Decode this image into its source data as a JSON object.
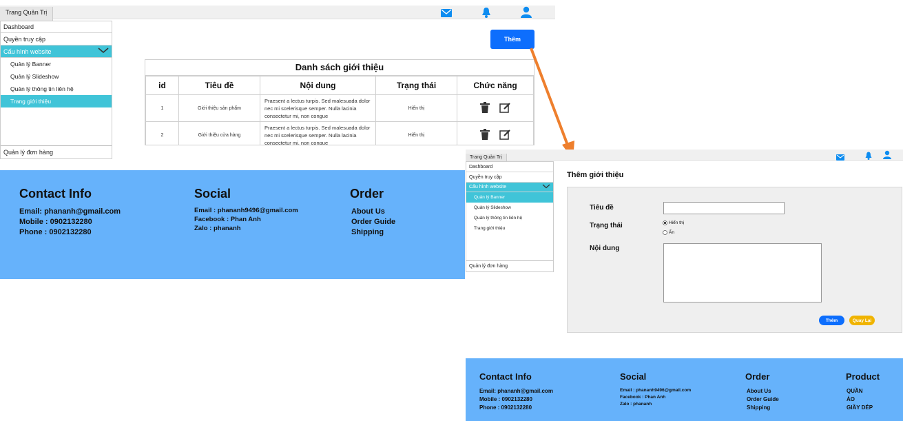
{
  "left": {
    "topbar": {
      "title": "Trang Quản Trị"
    },
    "sidebar": {
      "items": [
        "Dashboard",
        "Quyền truy cập",
        "Cấu hình website"
      ],
      "subitems": [
        "Quản lý Banner",
        "Quản lý Slideshow",
        "Quản lý thông tin liên hệ",
        "Trang giới thiệu"
      ],
      "bottom": "Quản lý đơn hàng"
    },
    "add_button": "Thêm",
    "table": {
      "caption": "Danh sách giới thiệu",
      "headers": [
        "id",
        "Tiêu đề",
        "Nội dung",
        "Trạng thái",
        "Chức năng"
      ],
      "rows": [
        {
          "id": "1",
          "title": "Giới thiệu sản phẩm",
          "content": "Praesent a lectus turpis. Sed malesuada dolor nec mi scelerisque semper. Nulla lacinia consectetur mi, non congue",
          "status": "Hiển thị"
        },
        {
          "id": "2",
          "title": "Giới thiệu cửa hàng",
          "content": "Praesent a lectus turpis. Sed malesuada dolor nec mi scelerisque semper. Nulla lacinia consectetur mi, non congue",
          "status": "Hiển thị"
        }
      ]
    },
    "footer": {
      "contact": {
        "title": "Contact Info",
        "lines": [
          "Email: phananh@gmail.com",
          "Mobile : 0902132280",
          "Phone : 0902132280"
        ]
      },
      "social": {
        "title": "Social",
        "lines": [
          "Email : phananh9496@gmail.com",
          "Facebook : Phan Anh",
          "Zalo : phananh"
        ]
      },
      "order": {
        "title": "Order",
        "lines": [
          "About Us",
          "Order Guide",
          "Shipping"
        ]
      }
    }
  },
  "right": {
    "topbar": {
      "title": "Trang Quản Trị"
    },
    "sidebar": {
      "items": [
        "Dashboard",
        "Quyền truy cập",
        "Cấu hình website"
      ],
      "subitems": [
        "Quản lý Banner",
        "Quản lý Slideshow",
        "Quản lý thông tin liên hệ",
        "Trang giới thiệu"
      ],
      "bottom": "Quản lý đơn hàng"
    },
    "form": {
      "heading": "Thêm giới thiệu",
      "title_label": "Tiêu đề",
      "title_value": "",
      "status_label": "Trạng thái",
      "radio_show": "Hiển thị",
      "radio_hide": "Ẩn",
      "content_label": "Nội dung",
      "content_value": "",
      "submit": "Thêm",
      "back": "Quay Lại"
    },
    "footer": {
      "contact": {
        "title": "Contact Info",
        "lines": [
          "Email: phananh@gmail.com",
          "Mobile : 0902132280",
          "Phone : 0902132280"
        ]
      },
      "social": {
        "title": "Social",
        "lines": [
          "Email : phananh9496@gmail.com",
          "Facebook : Phan Anh",
          "Zalo : phananh"
        ]
      },
      "order": {
        "title": "Order",
        "lines": [
          "About Us",
          "Order Guide",
          "Shipping"
        ]
      },
      "product": {
        "title": "Product",
        "lines": [
          "QUẦN",
          "ÁO",
          "GIẦY DÉP"
        ]
      }
    }
  },
  "colors": {
    "active": "#40c4d8",
    "footer": "#66b2fb",
    "primary": "#0d6efd",
    "warning": "#f0b400",
    "arrow": "#ee7f2d"
  }
}
